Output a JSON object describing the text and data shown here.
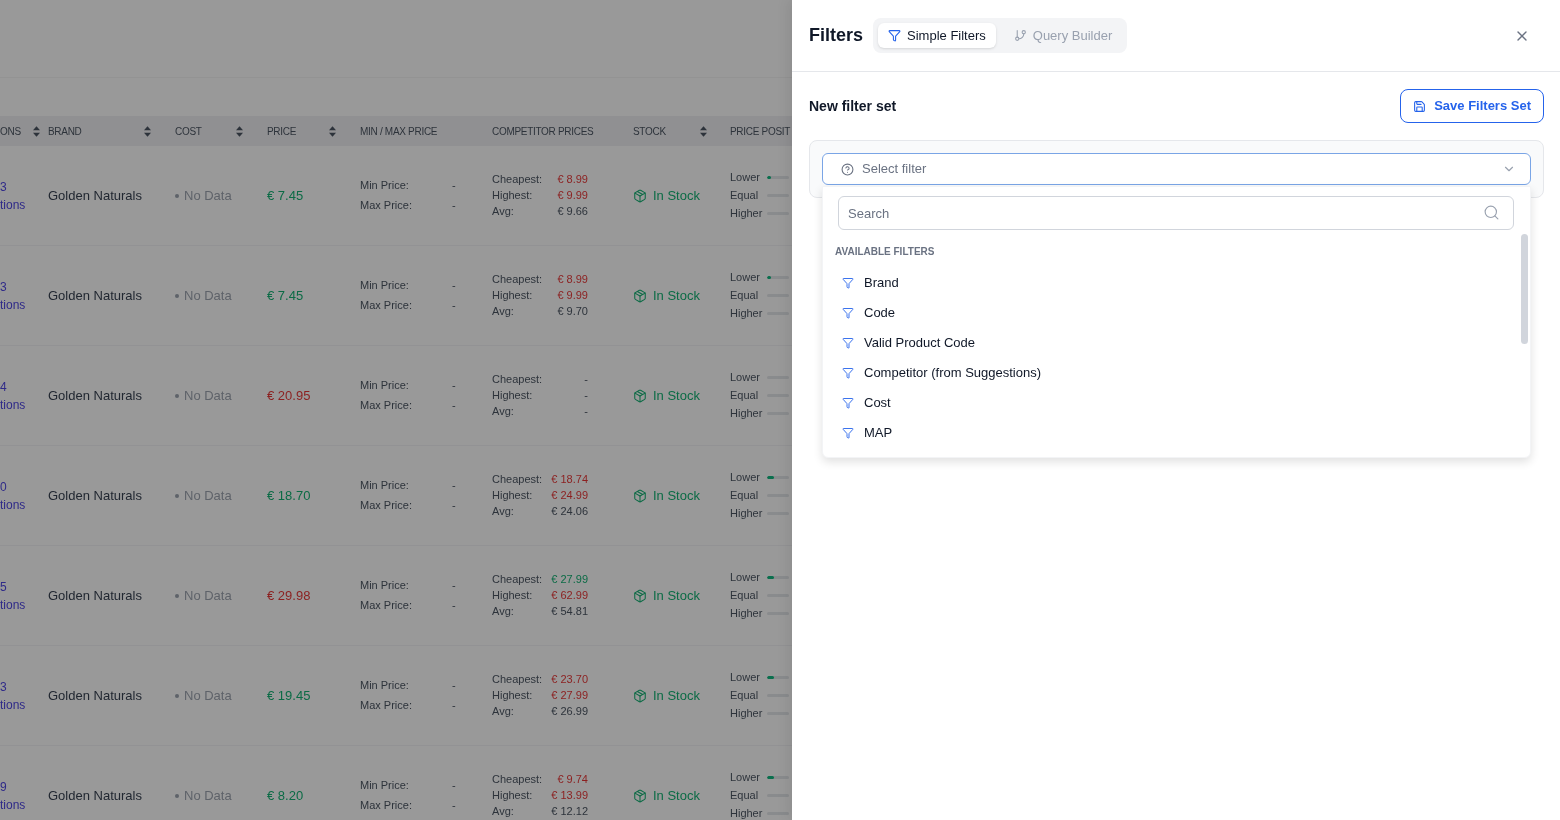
{
  "table": {
    "columns": [
      {
        "label": "ONS",
        "sortable": true
      },
      {
        "label": "BRAND",
        "sortable": true
      },
      {
        "label": "COST",
        "sortable": true
      },
      {
        "label": "PRICE",
        "sortable": true
      },
      {
        "label": "MIN / MAX PRICE",
        "sortable": false
      },
      {
        "label": "COMPETITOR PRICES",
        "sortable": false
      },
      {
        "label": "STOCK",
        "sortable": true
      },
      {
        "label": "PRICE POSIT",
        "sortable": false
      }
    ],
    "rows": [
      {
        "column_1": [
          "3",
          "tions"
        ],
        "brand": "Golden Naturals",
        "cost": "No Data",
        "price": {
          "text": "€ 7.45",
          "color": "#0b6b45"
        },
        "min_max": [
          {
            "label": "Min Price:",
            "value": "-"
          },
          {
            "label": "Max Price:",
            "value": "-"
          }
        ],
        "competitor_prices": [
          {
            "label": "Cheapest:",
            "value": "€ 8.99",
            "color": "#8c1f1f"
          },
          {
            "label": "Highest:",
            "value": "€ 9.99",
            "color": "#8c1f1f"
          },
          {
            "label": "Avg:",
            "value": "€ 9.66",
            "color": "#2d333b"
          }
        ],
        "stock": "In Stock",
        "price_position": [
          {
            "label": "Lower",
            "level": 0.2
          },
          {
            "label": "Equal",
            "level": 0
          },
          {
            "label": "Higher",
            "level": 0
          }
        ]
      },
      {
        "column_1": [
          "3",
          "tions"
        ],
        "brand": "Golden Naturals",
        "cost": "No Data",
        "price": {
          "text": "€ 7.45",
          "color": "#0b6b45"
        },
        "min_max": [
          {
            "label": "Min Price:",
            "value": "-"
          },
          {
            "label": "Max Price:",
            "value": "-"
          }
        ],
        "competitor_prices": [
          {
            "label": "Cheapest:",
            "value": "€ 8.99",
            "color": "#8c1f1f"
          },
          {
            "label": "Highest:",
            "value": "€ 9.99",
            "color": "#8c1f1f"
          },
          {
            "label": "Avg:",
            "value": "€ 9.70",
            "color": "#2d333b"
          }
        ],
        "stock": "In Stock",
        "price_position": [
          {
            "label": "Lower",
            "level": 0.2
          },
          {
            "label": "Equal",
            "level": 0
          },
          {
            "label": "Higher",
            "level": 0
          }
        ]
      },
      {
        "column_1": [
          "4",
          "tions"
        ],
        "brand": "Golden Naturals",
        "cost": "No Data",
        "price": {
          "text": "€ 20.95",
          "color": "#8c1f1f"
        },
        "min_max": [
          {
            "label": "Min Price:",
            "value": "-"
          },
          {
            "label": "Max Price:",
            "value": "-"
          }
        ],
        "competitor_prices": [
          {
            "label": "Cheapest:",
            "value": "-"
          },
          {
            "label": "Highest:",
            "value": "-"
          },
          {
            "label": "Avg:",
            "value": "-"
          }
        ],
        "stock": "In Stock",
        "price_position": [
          {
            "label": "Lower",
            "level": 0
          },
          {
            "label": "Equal",
            "level": 0
          },
          {
            "label": "Higher",
            "level": 0
          }
        ]
      },
      {
        "column_1": [
          "0",
          "tions"
        ],
        "brand": "Golden Naturals",
        "cost": "No Data",
        "price": {
          "text": "€ 18.70",
          "color": "#0b6b45"
        },
        "min_max": [
          {
            "label": "Min Price:",
            "value": "-"
          },
          {
            "label": "Max Price:",
            "value": "-"
          }
        ],
        "competitor_prices": [
          {
            "label": "Cheapest:",
            "value": "€ 18.74",
            "color": "#8c1f1f"
          },
          {
            "label": "Highest:",
            "value": "€ 24.99",
            "color": "#8c1f1f"
          },
          {
            "label": "Avg:",
            "value": "€ 24.06",
            "color": "#2d333b"
          }
        ],
        "stock": "In Stock",
        "price_position": [
          {
            "label": "Lower",
            "level": 0.3
          },
          {
            "label": "Equal",
            "level": 0
          },
          {
            "label": "Higher",
            "level": 0
          }
        ]
      },
      {
        "column_1": [
          "5",
          "tions"
        ],
        "brand": "Golden Naturals",
        "cost": "No Data",
        "price": {
          "text": "€ 29.98",
          "color": "#8c1f1f"
        },
        "min_max": [
          {
            "label": "Min Price:",
            "value": "-"
          },
          {
            "label": "Max Price:",
            "value": "-"
          }
        ],
        "competitor_prices": [
          {
            "label": "Cheapest:",
            "value": "€ 27.99",
            "color": "#0b6b45"
          },
          {
            "label": "Highest:",
            "value": "€ 62.99",
            "color": "#8c1f1f"
          },
          {
            "label": "Avg:",
            "value": "€ 54.81",
            "color": "#2d333b"
          }
        ],
        "stock": "In Stock",
        "price_position": [
          {
            "label": "Lower",
            "level": 0.3
          },
          {
            "label": "Equal",
            "level": 0
          },
          {
            "label": "Higher",
            "level": 0
          }
        ]
      },
      {
        "column_1": [
          "3",
          "tions"
        ],
        "brand": "Golden Naturals",
        "cost": "No Data",
        "price": {
          "text": "€ 19.45",
          "color": "#0b6b45"
        },
        "min_max": [
          {
            "label": "Min Price:",
            "value": "-"
          },
          {
            "label": "Max Price:",
            "value": "-"
          }
        ],
        "competitor_prices": [
          {
            "label": "Cheapest:",
            "value": "€ 23.70",
            "color": "#8c1f1f"
          },
          {
            "label": "Highest:",
            "value": "€ 27.99",
            "color": "#8c1f1f"
          },
          {
            "label": "Avg:",
            "value": "€ 26.99",
            "color": "#2d333b"
          }
        ],
        "stock": "In Stock",
        "price_position": [
          {
            "label": "Lower",
            "level": 0.3
          },
          {
            "label": "Equal",
            "level": 0
          },
          {
            "label": "Higher",
            "level": 0
          }
        ]
      },
      {
        "column_1": [
          "9",
          "tions"
        ],
        "brand": "Golden Naturals",
        "cost": "No Data",
        "price": {
          "text": "€ 8.20",
          "color": "#0b6b45"
        },
        "min_max": [
          {
            "label": "Min Price:",
            "value": "-"
          },
          {
            "label": "Max Price:",
            "value": "-"
          }
        ],
        "competitor_prices": [
          {
            "label": "Cheapest:",
            "value": "€ 9.74",
            "color": "#8c1f1f"
          },
          {
            "label": "Highest:",
            "value": "€ 13.99",
            "color": "#8c1f1f"
          },
          {
            "label": "Avg:",
            "value": "€ 12.12",
            "color": "#2d333b"
          }
        ],
        "stock": "In Stock",
        "price_position": [
          {
            "label": "Lower",
            "level": 0.3
          },
          {
            "label": "Equal",
            "level": 0
          },
          {
            "label": "Higher",
            "level": 0
          }
        ]
      }
    ]
  },
  "panel": {
    "title": "Filters",
    "tabs": [
      {
        "label": "Simple Filters",
        "selected": true
      },
      {
        "label": "Query Builder",
        "selected": false
      }
    ],
    "section_title": "New filter set",
    "save_button": "Save Filters Set",
    "filter_select": {
      "placeholder": "Select filter",
      "expanded": true
    },
    "dropdown": {
      "search": {
        "placeholder": "Search"
      },
      "heading": "AVAILABLE FILTERS",
      "items": [
        "Brand",
        "Code",
        "Valid Product Code",
        "Competitor (from Suggestions)",
        "Cost",
        "MAP"
      ]
    }
  }
}
